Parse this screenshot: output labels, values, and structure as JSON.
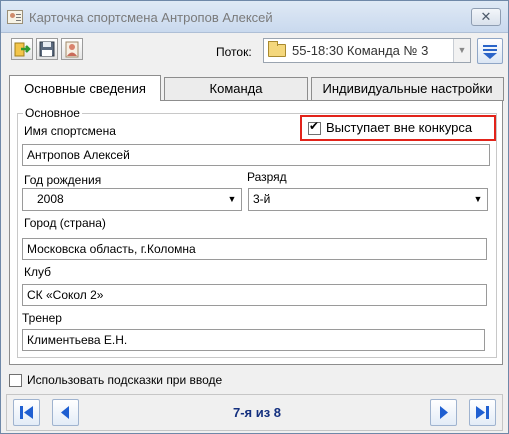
{
  "window": {
    "title": "Карточка спортсмена Антропов Алексей",
    "close_label": "✕"
  },
  "toolbar": {
    "flow_label": "Поток:",
    "flow_value": "55-18:30 Команда № 3"
  },
  "tabs": [
    {
      "label": "Основные сведения",
      "active": true
    },
    {
      "label": "Команда",
      "active": false
    },
    {
      "label": "Индивидуальные настройки",
      "active": false
    }
  ],
  "group": {
    "title": "Основное"
  },
  "fields": {
    "athlete_name": {
      "label": "Имя спортсмена",
      "value": "Антропов Алексей"
    },
    "out_of_competition": {
      "label": "Выступает вне конкурса",
      "checked": true
    },
    "birth_year": {
      "label": "Год рождения",
      "value": "2008"
    },
    "rank": {
      "label": "Разряд",
      "value": "3-й"
    },
    "city": {
      "label": "Город (страна)",
      "value": "Московска область, г.Коломна"
    },
    "club": {
      "label": "Клуб",
      "value": "СК «Сокол 2»"
    },
    "coach": {
      "label": "Тренер",
      "value": "Климентьева Е.Н."
    }
  },
  "bottom": {
    "hints_label": "Использовать подсказки при вводе",
    "hints_checked": false
  },
  "navigation": {
    "position_text": "7-я из 8"
  },
  "colors": {
    "highlight": "#e2231a",
    "nav_text": "#14307f",
    "nav_arrow": "#1f5fd1"
  }
}
